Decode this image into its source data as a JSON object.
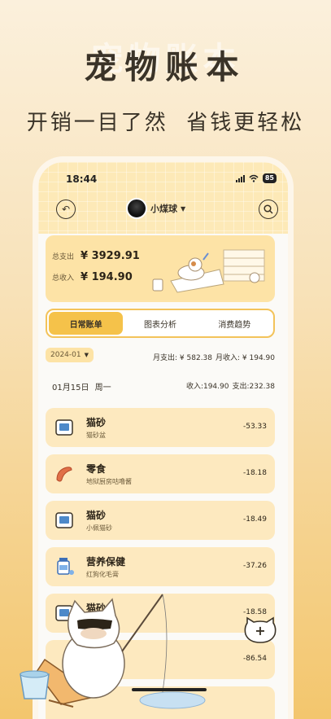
{
  "hero": {
    "ghost": "宠物账本",
    "title": "宠物账本",
    "subtitle": "开销一目了然  省钱更轻松"
  },
  "status_bar": {
    "time": "18:44",
    "battery": "85"
  },
  "header": {
    "pet_name": "小煤球",
    "back_icon": "back-arrow-icon",
    "search_icon": "search-icon"
  },
  "summary": {
    "expense_label": "总支出",
    "expense_value": "¥ 3929.91",
    "income_label": "总收入",
    "income_value": "¥ 194.90"
  },
  "tabs": [
    {
      "label": "日常账单",
      "active": true
    },
    {
      "label": "图表分析",
      "active": false
    },
    {
      "label": "消费趋势",
      "active": false
    }
  ],
  "month_filter": {
    "value": "2024-01",
    "month_expense": "月支出: ¥ 582.38",
    "month_income": "月收入: ¥ 194.90"
  },
  "day": {
    "date": "01月15日",
    "weekday": "周一",
    "income": "收入:194.90",
    "expense": "支出:232.38"
  },
  "entries": [
    {
      "category": "猫砂",
      "note": "猫砂盆",
      "amount": "-53.33",
      "icon": "litter-box-icon"
    },
    {
      "category": "零食",
      "note": "地狱厨房咕噜酱",
      "amount": "-18.18",
      "icon": "sausage-icon"
    },
    {
      "category": "猫砂",
      "note": "小佩猫砂",
      "amount": "-18.49",
      "icon": "litter-box-icon"
    },
    {
      "category": "营养保健",
      "note": "红狗化毛膏",
      "amount": "-37.26",
      "icon": "vitamin-bottle-icon"
    },
    {
      "category": "猫砂",
      "note": "猫砂",
      "amount": "-18.58",
      "icon": "litter-box-icon"
    },
    {
      "category": "",
      "note": "",
      "amount": "-86.54",
      "icon": ""
    }
  ],
  "fab": {
    "label": "+"
  },
  "colors": {
    "accent": "#f5c24a",
    "card": "#fde9bf",
    "summary": "#fde3a6"
  }
}
